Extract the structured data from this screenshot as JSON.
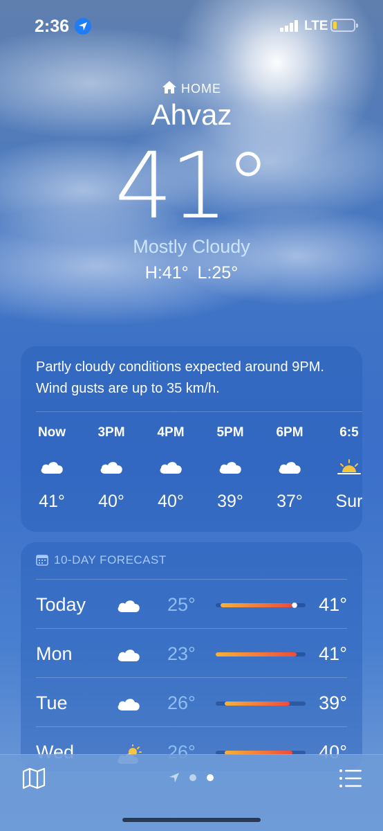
{
  "status_bar": {
    "time": "2:36",
    "network": "LTE"
  },
  "header": {
    "home_label": "HOME",
    "city": "Ahvaz",
    "temperature": "41°",
    "condition": "Mostly Cloudy",
    "high_low": "H:41°  L:25°"
  },
  "hourly": {
    "summary": "Partly cloudy conditions expected around 9PM. Wind gusts are up to 35 km/h.",
    "items": [
      {
        "label": "Now",
        "icon": "cloud-icon",
        "temp": "41°"
      },
      {
        "label": "3PM",
        "icon": "cloud-icon",
        "temp": "40°"
      },
      {
        "label": "4PM",
        "icon": "cloud-icon",
        "temp": "40°"
      },
      {
        "label": "5PM",
        "icon": "cloud-icon",
        "temp": "39°"
      },
      {
        "label": "6PM",
        "icon": "cloud-icon",
        "temp": "37°"
      },
      {
        "label": "6:5",
        "icon": "sunset-icon",
        "temp": "Sur"
      }
    ]
  },
  "forecast": {
    "title": "10-DAY FORECAST",
    "rows": [
      {
        "day": "Today",
        "icon": "cloud-icon",
        "low": "25°",
        "high": "41°",
        "range_start": 0.05,
        "range_end": 0.85,
        "current": 0.88
      },
      {
        "day": "Mon",
        "icon": "cloud-icon",
        "low": "23°",
        "high": "41°",
        "range_start": 0.0,
        "range_end": 0.9
      },
      {
        "day": "Tue",
        "icon": "cloud-icon",
        "low": "26°",
        "high": "39°",
        "range_start": 0.1,
        "range_end": 0.82
      },
      {
        "day": "Wed",
        "icon": "partly-sunny-icon",
        "low": "26°",
        "high": "40°",
        "range_start": 0.1,
        "range_end": 0.85
      }
    ]
  },
  "toolbar": {
    "page_count": 2,
    "active_page": 2
  },
  "colors": {
    "accent_blue": "#1f7cf2",
    "low_temp": "#8fbdf3",
    "range_start": "#f4b23a",
    "range_end": "#ef4b3d",
    "condition": "#cde4ff"
  }
}
